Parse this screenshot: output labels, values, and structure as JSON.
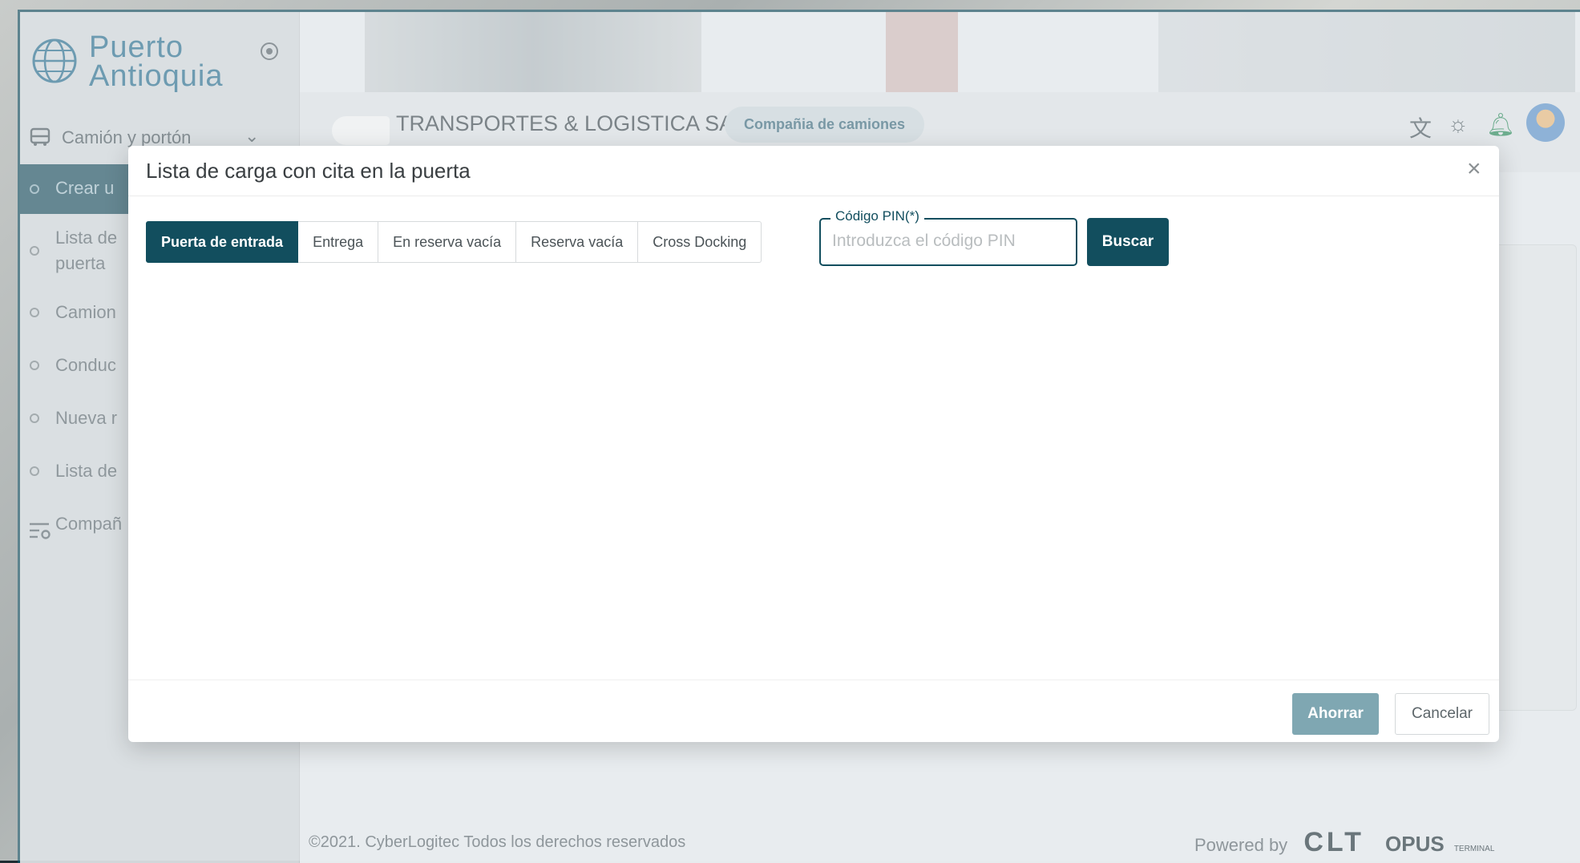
{
  "brand": {
    "name": "Puerto\nAntioquia"
  },
  "sidebar": {
    "group_label": "Camión y portón",
    "items": [
      {
        "label": "Crear u"
      },
      {
        "label": "Lista de\npuerta"
      },
      {
        "label": "Camion"
      },
      {
        "label": "Conduc"
      },
      {
        "label": "Nueva r"
      },
      {
        "label": "Lista de"
      }
    ],
    "company_label": "Compañ"
  },
  "header": {
    "company_name": "TRANSPORTES & LOGISTICA SAS",
    "company_badge": "Compañia de camiones"
  },
  "modal": {
    "title": "Lista de carga con cita en la puerta",
    "close_glyph": "×",
    "tabs": [
      {
        "label": "Puerta de entrada",
        "active": true
      },
      {
        "label": "Entrega",
        "active": false
      },
      {
        "label": "En reserva vacía",
        "active": false
      },
      {
        "label": "Reserva vacía",
        "active": false
      },
      {
        "label": "Cross Docking",
        "active": false
      }
    ],
    "pin": {
      "label": "Código PIN(*)",
      "placeholder": "Introduzca el código PIN",
      "value": ""
    },
    "search_label": "Buscar",
    "save_label": "Ahorrar",
    "cancel_label": "Cancelar"
  },
  "footer": {
    "copyright": "©2021. CyberLogitec Todos los derechos reservados",
    "powered_by": "Powered by",
    "clt": "CLT",
    "opus": "OPUS",
    "terminal": "TERMINAL"
  },
  "colors": {
    "primary": "#124e5e",
    "brand_text": "#2a6f8f",
    "save_disabled": "#7fa7b2"
  },
  "icons": [
    "globe-logo-icon",
    "radio-icon",
    "bus-icon",
    "chevron-down-icon",
    "company-settings-icon",
    "translate-icon",
    "sun-icon",
    "bell-icon",
    "avatar",
    "close-icon"
  ]
}
